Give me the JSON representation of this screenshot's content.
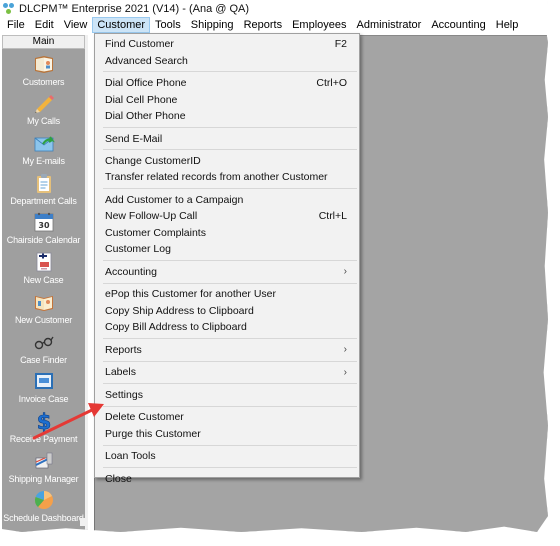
{
  "window": {
    "title": "DLCPM™ Enterprise 2021 (V14) - (Ana @ QA)",
    "app_icon": "network-nodes-icon"
  },
  "menubar": {
    "items": [
      {
        "label": "File"
      },
      {
        "label": "Edit"
      },
      {
        "label": "View"
      },
      {
        "label": "Customer",
        "active": true
      },
      {
        "label": "Tools"
      },
      {
        "label": "Shipping"
      },
      {
        "label": "Reports"
      },
      {
        "label": "Employees"
      },
      {
        "label": "Administrator"
      },
      {
        "label": "Accounting"
      },
      {
        "label": "Help"
      }
    ]
  },
  "sidebar": {
    "header": "Main",
    "items": [
      {
        "label": "Customers",
        "icon": "address-book-icon"
      },
      {
        "label": "My Calls",
        "icon": "pencil-icon"
      },
      {
        "label": "My E-mails",
        "icon": "envelope-icon"
      },
      {
        "label": "Department Calls",
        "icon": "clipboard-icon"
      },
      {
        "label": "Chairside Calendar",
        "icon": "calendar-icon",
        "icon_text": "30"
      },
      {
        "label": "New Case",
        "icon": "new-document-icon"
      },
      {
        "label": "New Customer",
        "icon": "open-book-icon"
      },
      {
        "label": "Case Finder",
        "icon": "glasses-icon"
      },
      {
        "label": "Invoice Case",
        "icon": "invoice-icon"
      },
      {
        "label": "Receive Payment",
        "icon": "dollar-icon"
      },
      {
        "label": "Shipping Manager",
        "icon": "shipping-icon"
      },
      {
        "label": "Schedule Dashboard",
        "icon": "pie-chart-icon"
      }
    ]
  },
  "customer_menu": {
    "groups": [
      [
        {
          "label": "Find Customer",
          "shortcut": "F2"
        },
        {
          "label": "Advanced Search"
        }
      ],
      [
        {
          "label": "Dial Office Phone",
          "shortcut": "Ctrl+O"
        },
        {
          "label": "Dial Cell Phone"
        },
        {
          "label": "Dial Other Phone"
        }
      ],
      [
        {
          "label": "Send E-Mail"
        }
      ],
      [
        {
          "label": "Change CustomerID"
        },
        {
          "label": "Transfer related records from another Customer"
        }
      ],
      [
        {
          "label": "Add Customer to a Campaign"
        },
        {
          "label": "New Follow-Up Call",
          "shortcut": "Ctrl+L"
        },
        {
          "label": "Customer Complaints"
        },
        {
          "label": "Customer Log"
        }
      ],
      [
        {
          "label": "Accounting",
          "submenu": true
        }
      ],
      [
        {
          "label": "ePop this Customer for another User"
        },
        {
          "label": "Copy Ship Address to Clipboard"
        },
        {
          "label": "Copy Bill Address to Clipboard"
        }
      ],
      [
        {
          "label": "Reports",
          "submenu": true
        }
      ],
      [
        {
          "label": "Labels",
          "submenu": true
        }
      ],
      [
        {
          "label": "Settings"
        }
      ],
      [
        {
          "label": "Delete Customer",
          "annotated": true
        },
        {
          "label": "Purge this Customer"
        }
      ],
      [
        {
          "label": "Loan Tools"
        }
      ],
      [
        {
          "label": "Close"
        }
      ]
    ],
    "submenu_glyph": "›"
  },
  "annotation": {
    "type": "arrow",
    "points_to": "Delete Customer",
    "color": "#e53935"
  },
  "colors": {
    "sidebar_bg": "#9f9f9f",
    "workspace_bg": "#a4a4a4",
    "menu_bg": "#f2f2f2",
    "menu_highlight": "#cce4f7"
  }
}
